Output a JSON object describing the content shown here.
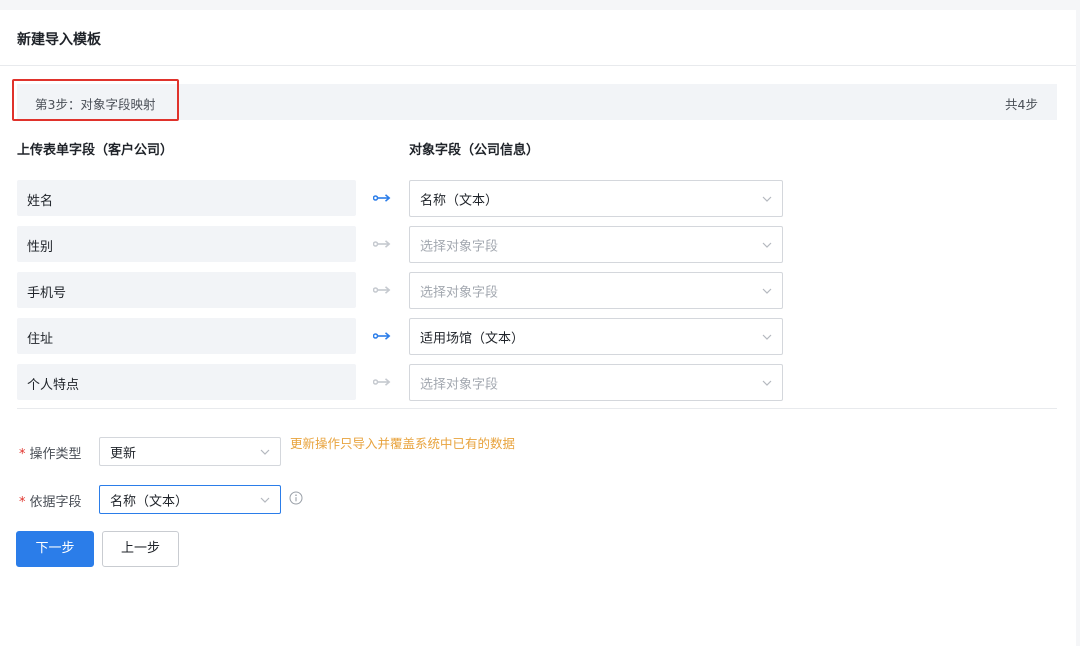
{
  "page": {
    "title": "新建导入模板"
  },
  "step": {
    "current": "第3步：对象字段映射",
    "total": "共4步"
  },
  "columns": {
    "source": "上传表单字段（客户公司）",
    "target": "对象字段（公司信息）"
  },
  "mapping": [
    {
      "source": "姓名",
      "target": "名称（文本）",
      "mapped": true
    },
    {
      "source": "性别",
      "target": "选择对象字段",
      "mapped": false
    },
    {
      "source": "手机号",
      "target": "选择对象字段",
      "mapped": false
    },
    {
      "source": "住址",
      "target": "适用场馆（文本）",
      "mapped": true
    },
    {
      "source": "个人特点",
      "target": "选择对象字段",
      "mapped": false
    }
  ],
  "form": {
    "operation": {
      "label": "操作类型",
      "required_mark": "*",
      "value": "更新",
      "hint": "更新操作只导入并覆盖系统中已有的数据"
    },
    "basis": {
      "label": "依据字段",
      "required_mark": "*",
      "value": "名称（文本）"
    }
  },
  "buttons": {
    "next": "下一步",
    "prev": "上一步"
  },
  "icons": {
    "mapped_arrow": "link-arrow-icon",
    "unmapped_arrow": "link-arrow-icon",
    "dropdown": "chevron-down-icon",
    "info": "info-circle-icon"
  },
  "colors": {
    "accent": "#2b7de9",
    "muted_arrow": "#c5c9cf",
    "warning_text": "#e8a33d",
    "highlight_box": "#e0322b",
    "required": "#e0322b"
  }
}
